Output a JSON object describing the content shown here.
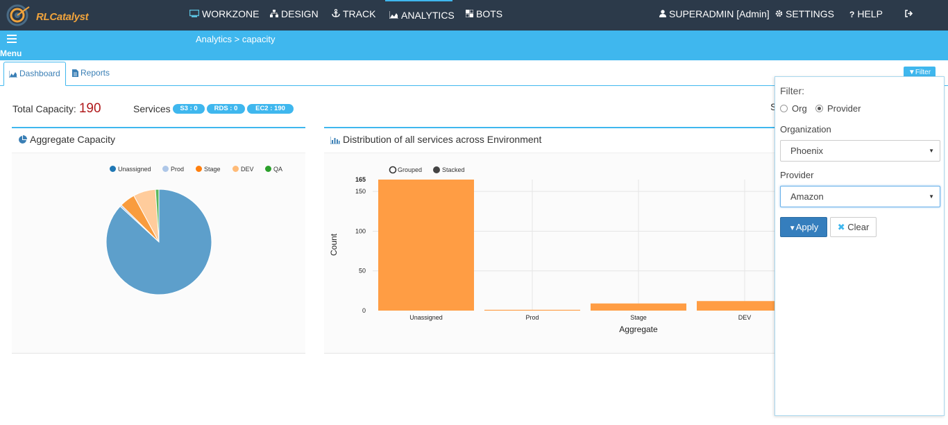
{
  "brand": {
    "name": "RLCatalyst"
  },
  "nav": {
    "items": [
      {
        "label": "WORKZONE",
        "icon": "monitor-icon"
      },
      {
        "label": "DESIGN",
        "icon": "sitemap-icon"
      },
      {
        "label": "TRACK",
        "icon": "anchor-icon"
      },
      {
        "label": "ANALYTICS",
        "icon": "area-chart-icon",
        "active": true
      },
      {
        "label": "BOTS",
        "icon": "grid-icon"
      }
    ],
    "user": "SUPERADMIN [Admin]",
    "settings": "SETTINGS",
    "help": "HELP"
  },
  "subbar": {
    "menu_label": "Menu",
    "breadcrumb": "Analytics > capacity"
  },
  "tabs": [
    {
      "label": "Dashboard",
      "active": true
    },
    {
      "label": "Reports",
      "active": false
    }
  ],
  "filter_button": "Filter",
  "summary": {
    "total_label": "Total Capacity:",
    "total_value": "190",
    "services_label": "Services",
    "badges": [
      "S3 : 0",
      "RDS : 0",
      "EC2 : 190"
    ],
    "truncated_label": "S"
  },
  "panels": {
    "aggregate_title": "Aggregate Capacity",
    "distribution_title": "Distribution of all services across Environment"
  },
  "chart_data": [
    {
      "type": "pie",
      "title": "Aggregate Capacity",
      "legend": [
        "Unassigned",
        "Prod",
        "Stage",
        "DEV",
        "QA"
      ],
      "colors": [
        "#1f77b4",
        "#aec7e8",
        "#ff7f0e",
        "#ffbb78",
        "#2ca02c"
      ],
      "values": [
        165,
        1,
        9,
        13,
        2
      ]
    },
    {
      "type": "bar",
      "title": "Distribution of all services across Environment",
      "modes": [
        "Grouped",
        "Stacked"
      ],
      "selected_mode": "Stacked",
      "categories": [
        "Unassigned",
        "Prod",
        "Stage",
        "DEV"
      ],
      "values": [
        165,
        1,
        9,
        12
      ],
      "color": "#ff9d44",
      "xlabel": "Aggregate",
      "ylabel": "Count",
      "ylim": [
        0,
        165
      ],
      "yticks": [
        0,
        50,
        100,
        150,
        165
      ]
    }
  ],
  "filter_panel": {
    "title": "Filter:",
    "radio_options": [
      {
        "label": "Org",
        "checked": false
      },
      {
        "label": "Provider",
        "checked": true
      }
    ],
    "organization_label": "Organization",
    "organization_value": "Phoenix",
    "provider_label": "Provider",
    "provider_value": "Amazon",
    "apply_label": "Apply",
    "clear_label": "Clear"
  }
}
